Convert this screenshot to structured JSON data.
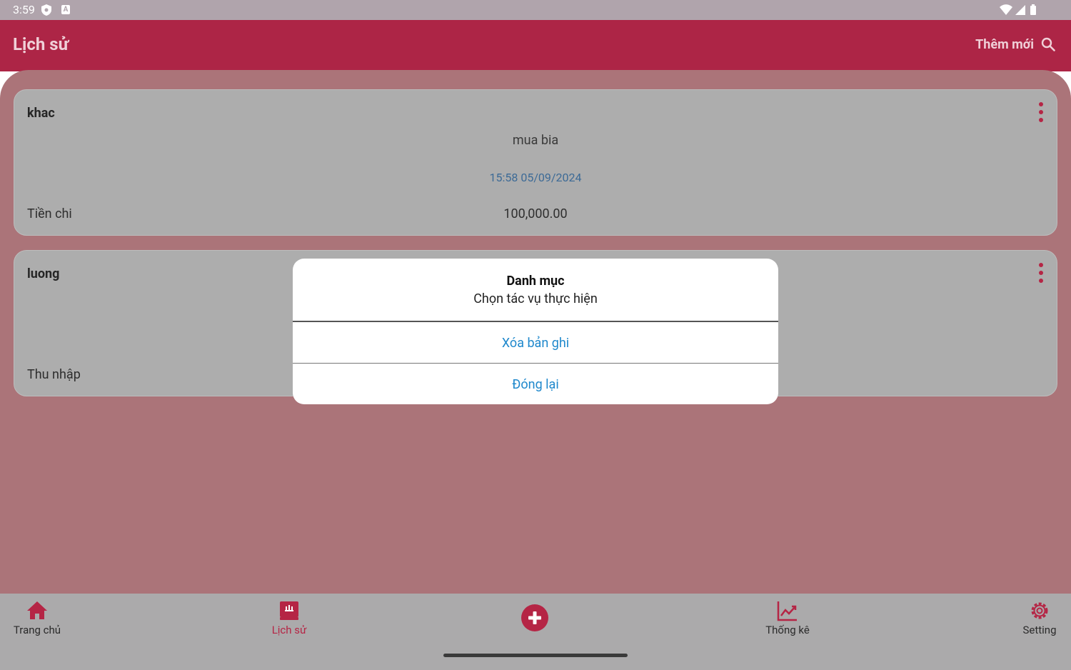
{
  "status_bar": {
    "time": "3:59",
    "icons": [
      "shield-icon",
      "a-icon",
      "wifi-icon",
      "signal-icon",
      "battery-icon"
    ]
  },
  "app_bar": {
    "title": "Lịch sử",
    "add_new_label": "Thêm mới",
    "search_icon": "search-icon"
  },
  "records": [
    {
      "category": "khac",
      "note": "mua bia",
      "datetime": "15:58 05/09/2024",
      "type": "Tiền chi",
      "amount": "100,000.00"
    },
    {
      "category": "luong",
      "note": "",
      "datetime": "",
      "type": "Thu nhập",
      "amount": ""
    }
  ],
  "dialog": {
    "title": "Danh mục",
    "message": "Chọn tác vụ thực hiện",
    "actions": [
      "Xóa bản ghi",
      "Đóng lại"
    ]
  },
  "bottom_nav": {
    "items": [
      {
        "label": "Trang chủ",
        "icon": "home-icon"
      },
      {
        "label": "Lịch sử",
        "icon": "history-icon",
        "active": true
      },
      {
        "label": "",
        "icon": "add-circle-icon"
      },
      {
        "label": "Thống kê",
        "icon": "chart-icon"
      },
      {
        "label": "Setting",
        "icon": "gear-icon"
      }
    ]
  },
  "colors": {
    "primary": "#ad2546",
    "app_bar": "#ad2546",
    "overlay_bg": "#ab7479",
    "card_bg": "#adadad",
    "dialog_action": "#1f88cc",
    "date_text": "#3c6a96"
  }
}
